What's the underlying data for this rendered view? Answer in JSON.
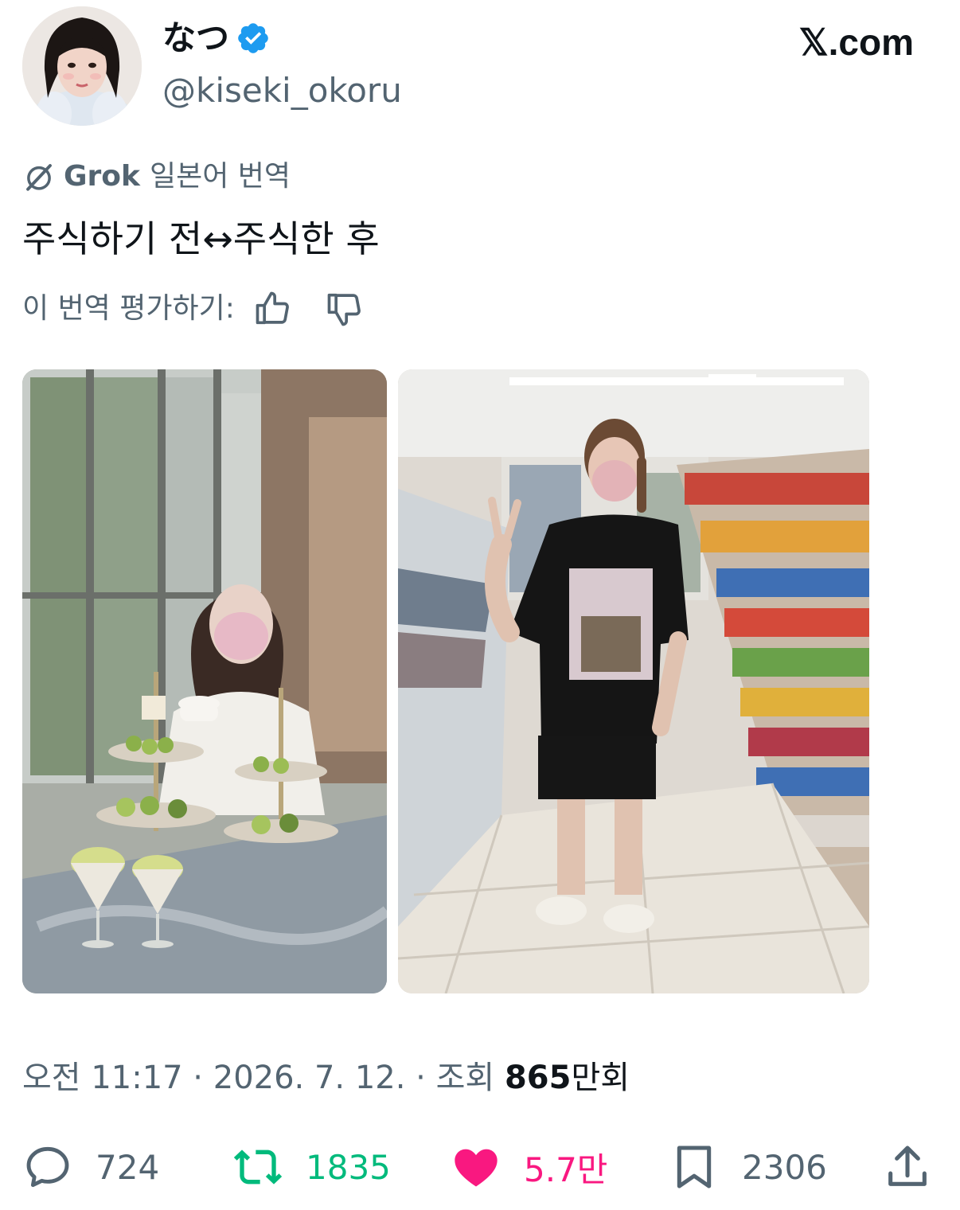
{
  "header": {
    "display_name": "なつ",
    "handle": "@kiseki_okoru",
    "site": "𝕏.com",
    "verified_icon": "verified-badge-icon"
  },
  "translation": {
    "brand": "Grok",
    "label": "일본어 번역",
    "text": "주식하기 전↔주식한 후",
    "rate_prompt": "이 번역 평가하기:"
  },
  "media": [
    {
      "name": "photo-afternoon-tea"
    },
    {
      "name": "photo-convenience-store"
    }
  ],
  "meta": {
    "time": "오전 11:17",
    "sep1": " · ",
    "date": "2026. 7. 12.",
    "sep2": " · ",
    "views_label": "조회 ",
    "views_number": "865",
    "views_unit": "만회"
  },
  "actions": {
    "reply_count": "724",
    "retweet_count": "1835",
    "like_count": "5.7만",
    "bookmark_count": "2306"
  },
  "colors": {
    "text_primary": "#0f1419",
    "text_secondary": "#536471",
    "verified": "#1d9bf0",
    "retweet_active": "#00ba7c",
    "like_active": "#f91880"
  }
}
